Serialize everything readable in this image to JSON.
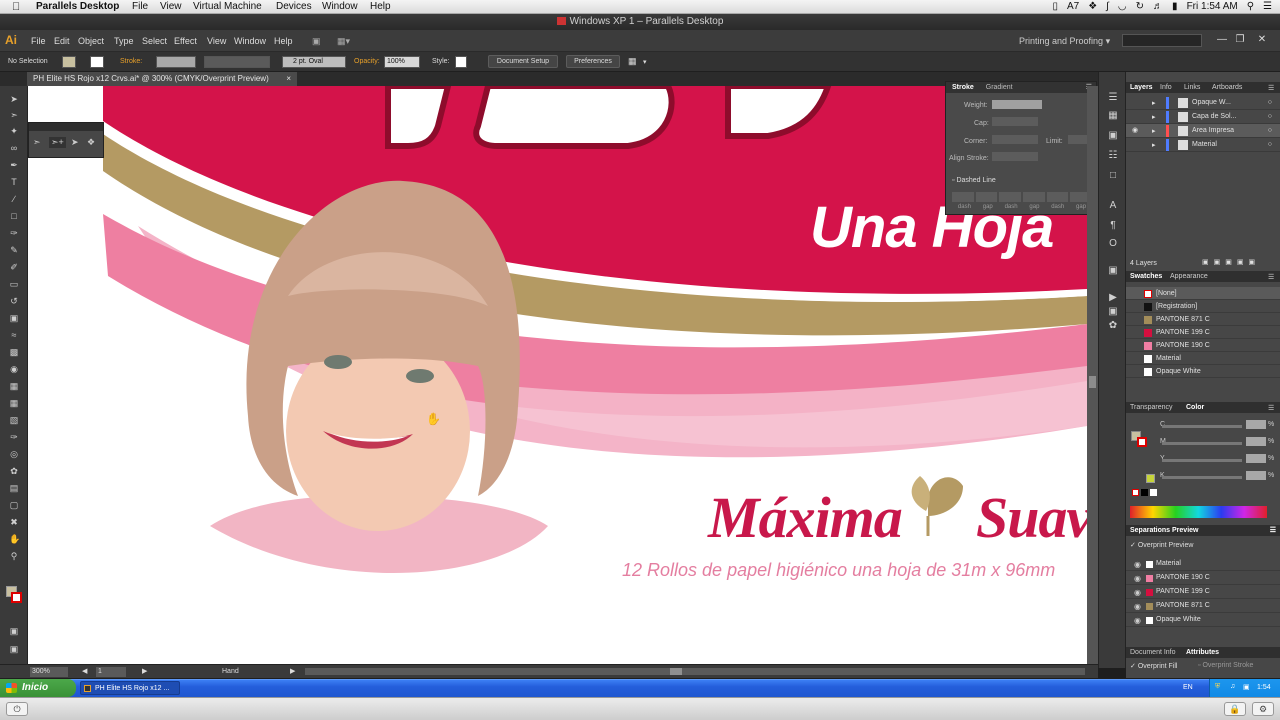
{
  "mac_menubar": {
    "app": "Parallels Desktop",
    "menus": [
      "File",
      "View",
      "Virtual Machine",
      "Devices",
      "Window",
      "Help"
    ],
    "tray_num": "7",
    "clock": "Fri 1:54 AM"
  },
  "window_title": "Windows XP 1 – Parallels Desktop",
  "illustrator": {
    "logo": "Ai",
    "menus": [
      "File",
      "Edit",
      "Object",
      "Type",
      "Select",
      "Effect",
      "View",
      "Window",
      "Help"
    ],
    "workspace": "Printing and Proofing",
    "control": {
      "selection": "No Selection",
      "stroke_label": "Stroke:",
      "brush": "2 pt. Oval",
      "opacity_label": "Opacity:",
      "opacity_value": "100%",
      "style_label": "Style:",
      "doc_setup": "Document Setup",
      "preferences": "Preferences"
    },
    "document_tab": "PH Elite HS Rojo x12 Crvs.ai* @ 300% (CMYK/Overprint Preview)",
    "doc_close": "×"
  },
  "artwork": {
    "headline": "Una Hoja",
    "maxima": "Máxima",
    "suave": "Suav",
    "subline": "12 Rollos de papel higiénico una hoja de 31m x 96mm"
  },
  "stroke_panel": {
    "tabs": [
      "Stroke",
      "Gradient"
    ],
    "weight": "Weight:",
    "cap": "Cap:",
    "corner": "Corner:",
    "limit": "Limit:",
    "align": "Align Stroke:",
    "dashed": "Dashed Line",
    "dash_labels": [
      "dash",
      "gap",
      "dash",
      "gap",
      "dash",
      "gap"
    ]
  },
  "layers_panel": {
    "tabs": [
      "Layers",
      "Info",
      "Links",
      "Artboards"
    ],
    "layers": [
      {
        "name": "Opaque W...",
        "color": "#4f7cff"
      },
      {
        "name": "Capa de Sol...",
        "color": "#4f7cff"
      },
      {
        "name": "Area Impresa",
        "color": "#ff4f4f"
      },
      {
        "name": "Material",
        "color": "#4f7cff"
      }
    ],
    "count": "4 Layers"
  },
  "swatches_panel": {
    "tabs": [
      "Swatches",
      "Appearance"
    ],
    "items": [
      {
        "name": "[None]",
        "color": "#ffffff"
      },
      {
        "name": "[Registration]",
        "color": "#111111"
      },
      {
        "name": "PANTONE 871 C",
        "color": "#a38d5a"
      },
      {
        "name": "PANTONE 199 C",
        "color": "#d50f3f"
      },
      {
        "name": "PANTONE 190 C",
        "color": "#f07ea3"
      },
      {
        "name": "Material",
        "color": "#ffffff"
      },
      {
        "name": "Opaque White",
        "color": "#ffffff"
      }
    ]
  },
  "color_panel": {
    "tabs": [
      "Transparency",
      "Color"
    ],
    "channels": [
      "C",
      "M",
      "Y",
      "K"
    ],
    "percent": "%"
  },
  "separations_panel": {
    "title": "Separations Preview",
    "overprint": "Overprint Preview",
    "items": [
      {
        "name": "Material",
        "color": "#ffffff"
      },
      {
        "name": "PANTONE 190 C",
        "color": "#f07ea3"
      },
      {
        "name": "PANTONE 199 C",
        "color": "#d50f3f"
      },
      {
        "name": "PANTONE 871 C",
        "color": "#a38d5a"
      },
      {
        "name": "Opaque White",
        "color": "#ffffff"
      }
    ]
  },
  "attributes_panel": {
    "tabs": [
      "Document Info",
      "Attributes"
    ],
    "overprint_fill": "Overprint Fill",
    "overprint_stroke": "Overprint Stroke"
  },
  "statusbar": {
    "zoom": "300%",
    "artboard": "1",
    "tool": "Hand"
  },
  "xp_taskbar": {
    "start": "Inicio",
    "task": "PH Elite HS Rojo x12 ...",
    "lang": "EN",
    "time": "1:54"
  }
}
